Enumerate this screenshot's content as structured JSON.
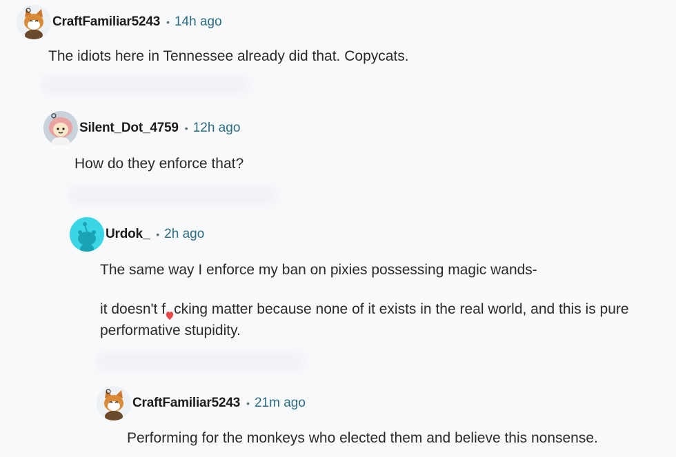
{
  "comments": [
    {
      "username": "CraftFamiliar5243",
      "separator": "•",
      "time": "14h ago",
      "text": [
        "The idiots here in Tennessee already did that. Copycats."
      ],
      "avatar": "snoo-fox-avatar",
      "avatar_bg": "#eef1f4"
    },
    {
      "username": "Silent_Dot_4759",
      "separator": "•",
      "time": "12h ago",
      "text": [
        "How do they enforce that?"
      ],
      "avatar": "snoo-hooded-avatar",
      "avatar_bg": "#c8d3dc"
    },
    {
      "username": "Urdok_",
      "separator": "•",
      "time": "2h ago",
      "text_line1": "The same way I enforce my ban on pixies possessing magic wands-",
      "text_line2_pre": "it doesn't f",
      "text_line2_post": "cking matter because none of it exists in the real world, and this is pure",
      "text_line3": "performative stupidity.",
      "avatar": "snoo-default-avatar",
      "avatar_bg": "#3ad6e6"
    },
    {
      "username": "CraftFamiliar5243",
      "separator": "•",
      "time": "21m ago",
      "text": [
        "Performing for the monkeys who elected them and believe this nonsense."
      ],
      "avatar": "snoo-fox-avatar",
      "avatar_bg": "#eef1f4"
    }
  ],
  "colors": {
    "background": "#f8f9fb",
    "timestamp": "#2a6d84",
    "text": "#2a2a2a",
    "censor_heart": "#e8494b"
  }
}
